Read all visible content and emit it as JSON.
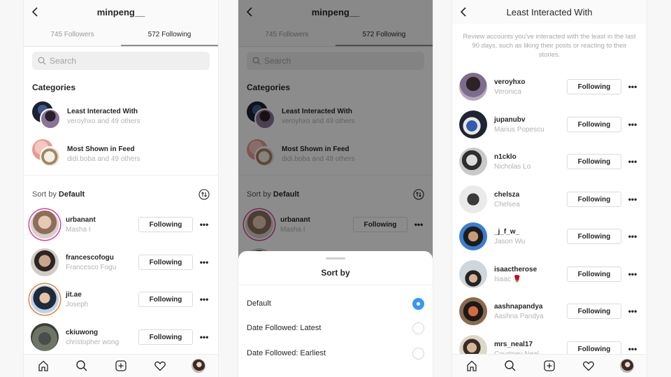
{
  "colors": {
    "accent": "#3897f0",
    "story_ring_start": "#d6449a",
    "story_ring_end": "#e8813c"
  },
  "following_screen": {
    "title": "minpeng__",
    "tabs": [
      {
        "label": "745 Followers"
      },
      {
        "label": "572 Following"
      }
    ],
    "search_placeholder": "Search",
    "categories_heading": "Categories",
    "categories": [
      {
        "title": "Least Interacted With",
        "subtitle": "veroyhxo and 49 others"
      },
      {
        "title": "Most Shown in Feed",
        "subtitle": "didi.boba and 49 others"
      }
    ],
    "sort_prefix": "Sort by ",
    "sort_value": "Default",
    "users": [
      {
        "username": "urbanant",
        "name": "Masha I",
        "button": "Following",
        "story": true
      },
      {
        "username": "francescofogu",
        "name": "Francesco Fogu",
        "button": "Following",
        "story": false
      },
      {
        "username": "jit.ae",
        "name": "Joseph",
        "button": "Following",
        "story": true
      },
      {
        "username": "ckiuwong",
        "name": "christopher wong",
        "button": "Following",
        "story": false
      }
    ],
    "more_label": "•••"
  },
  "sort_sheet": {
    "title": "Sort by",
    "options": [
      {
        "label": "Default",
        "selected": true
      },
      {
        "label": "Date Followed: Latest",
        "selected": false
      },
      {
        "label": "Date Followed: Earliest",
        "selected": false
      }
    ]
  },
  "least_interacted_screen": {
    "title": "Least Interacted With",
    "description": "Review accounts you've interacted with the least in the last 90 days, such as liking their posts or reacting to their stories.",
    "users": [
      {
        "username": "veroyhxo",
        "name": "Veronica",
        "button": "Following"
      },
      {
        "username": "jupanubv",
        "name": "Marius Popescu",
        "button": "Following"
      },
      {
        "username": "n1cklo",
        "name": "Nicholas Lo",
        "button": "Following"
      },
      {
        "username": "chelsza",
        "name": "Chelsea",
        "button": "Following"
      },
      {
        "username": "_j_f_w_",
        "name": "Jason Wu",
        "button": "Following"
      },
      {
        "username": "isaactherose",
        "name": "Isaac 🌹",
        "button": "Following"
      },
      {
        "username": "aashnapandya",
        "name": "Aashna Pandya",
        "button": "Following"
      },
      {
        "username": "mrs_neal17",
        "name": "Courtney Neal",
        "button": "Following"
      }
    ]
  },
  "tabbar": {
    "icons": [
      "home-icon",
      "search-icon",
      "new-post-icon",
      "activity-heart-icon",
      "profile-avatar"
    ]
  }
}
